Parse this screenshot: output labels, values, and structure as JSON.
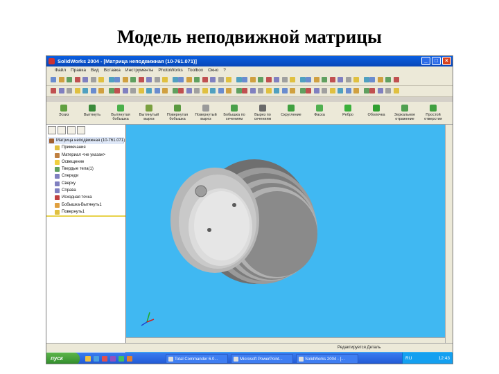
{
  "slide_title": "Модель неподвижной матрицы",
  "window": {
    "title": "SolidWorks 2004 - [Матрица неподвижная (10-761.071)]",
    "min_label": "_",
    "max_label": "□",
    "close_label": "×"
  },
  "menubar": {
    "items": [
      "Файл",
      "Правка",
      "Вид",
      "Вставка",
      "Инструменты",
      "PhotoWorks",
      "Toolbox",
      "Окно",
      "?"
    ]
  },
  "command_manager": {
    "buttons": [
      "Эскиз",
      "Вытянуть",
      "Вытянутая бобышка",
      "Вытянутый вырез",
      "Повернутая бобышка",
      "Повернутый вырез",
      "Бобышка по сечениям",
      "Вырез по сечениям",
      "Скругление",
      "Фаска",
      "Ребро",
      "Оболочка",
      "Зеркальное отражение",
      "Простой отверстия"
    ]
  },
  "feature_tree": {
    "items": [
      "Матрица неподвижная (10-761.071)",
      "Примечания",
      "Материал <не указан>",
      "Освещение",
      "Твердые тела(1)",
      "Спереди",
      "Сверху",
      "Справа",
      "Исходная точка",
      "Бобышка-Вытянуть1",
      "Повернуть1"
    ]
  },
  "status_bar": {
    "text": "Редактируется Деталь"
  },
  "taskbar": {
    "start_label": "пуск",
    "tasks": [
      "Total Commander 6.0...",
      "Microsoft PowerPoint...",
      "SolidWorks 2004 - [..."
    ],
    "language": "RU",
    "clock": "12:43"
  },
  "colors": {
    "viewport": "#40b8f2",
    "titlebar": "#0a5fe0",
    "taskbar": "#1f56d3"
  }
}
